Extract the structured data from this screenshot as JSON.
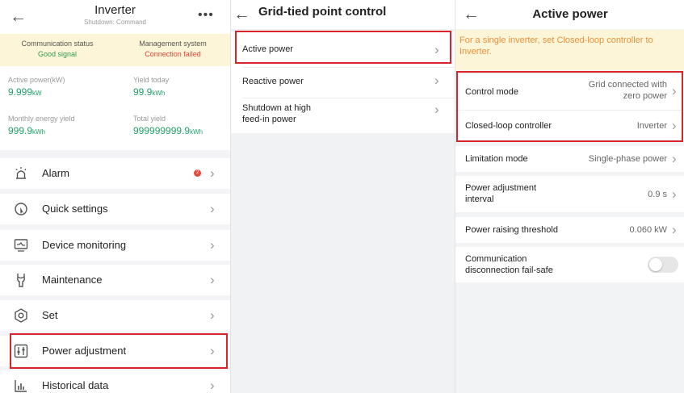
{
  "inverter_screen": {
    "title": "Inverter",
    "subtitle": "Shutdown: Command",
    "more_icon": "more-dots-icon",
    "status": {
      "communication_label": "Communication status",
      "communication_value": "Good signal",
      "management_label": "Management system",
      "management_value": "Connection failed"
    },
    "metrics": [
      {
        "label": "Active power(kW)",
        "value": "9.999",
        "unit": "kW"
      },
      {
        "label": "Yield today",
        "value": "99.9",
        "unit": "kWh"
      },
      {
        "label": "Monthly energy yield",
        "value": "999.9",
        "unit": "kWh"
      },
      {
        "label": "Total yield",
        "value": "999999999.9",
        "unit": "kWh"
      }
    ],
    "menu": [
      {
        "label": "Alarm",
        "icon": "alarm-icon",
        "badge": "2"
      },
      {
        "label": "Quick settings",
        "icon": "quick-settings-icon"
      },
      {
        "label": "Device monitoring",
        "icon": "monitor-icon"
      },
      {
        "label": "Maintenance",
        "icon": "maintenance-icon"
      },
      {
        "label": "Set",
        "icon": "settings-icon"
      },
      {
        "label": "Power adjustment",
        "icon": "power-adjustment-icon"
      },
      {
        "label": "Historical data",
        "icon": "historical-data-icon"
      }
    ]
  },
  "grid_screen": {
    "title": "Grid-tied point control",
    "items": [
      {
        "label": "Active power"
      },
      {
        "label": "Reactive power"
      },
      {
        "label_line1": "Shutdown at high",
        "label_line2": "feed-in power"
      }
    ]
  },
  "active_power_screen": {
    "title": "Active power",
    "notice": "For a single inverter, set Closed-loop controller to Inverter.",
    "rows": [
      {
        "label": "Control mode",
        "value_line1": "Grid connected with",
        "value_line2": "zero power"
      },
      {
        "label": "Closed-loop controller",
        "value": "Inverter"
      },
      {
        "label": "Limitation mode",
        "value": "Single-phase power"
      },
      {
        "label_line1": "Power adjustment",
        "label_line2": "interval",
        "value": "0.9 s"
      },
      {
        "label": "Power raising threshold",
        "value": "0.060 kW"
      },
      {
        "label_line1": "Communication",
        "label_line2": "disconnection fail-safe",
        "toggle": "off"
      }
    ]
  },
  "colors": {
    "highlight": "#d9242b",
    "good": "#2f9a52",
    "bad": "#e0453a",
    "metric_value": "#23a06a",
    "notice_text": "#e8913b",
    "notice_bg": "#fdf5d8"
  },
  "icons": {
    "back": "back-arrow-icon",
    "chevron": "chevron-right-icon"
  }
}
